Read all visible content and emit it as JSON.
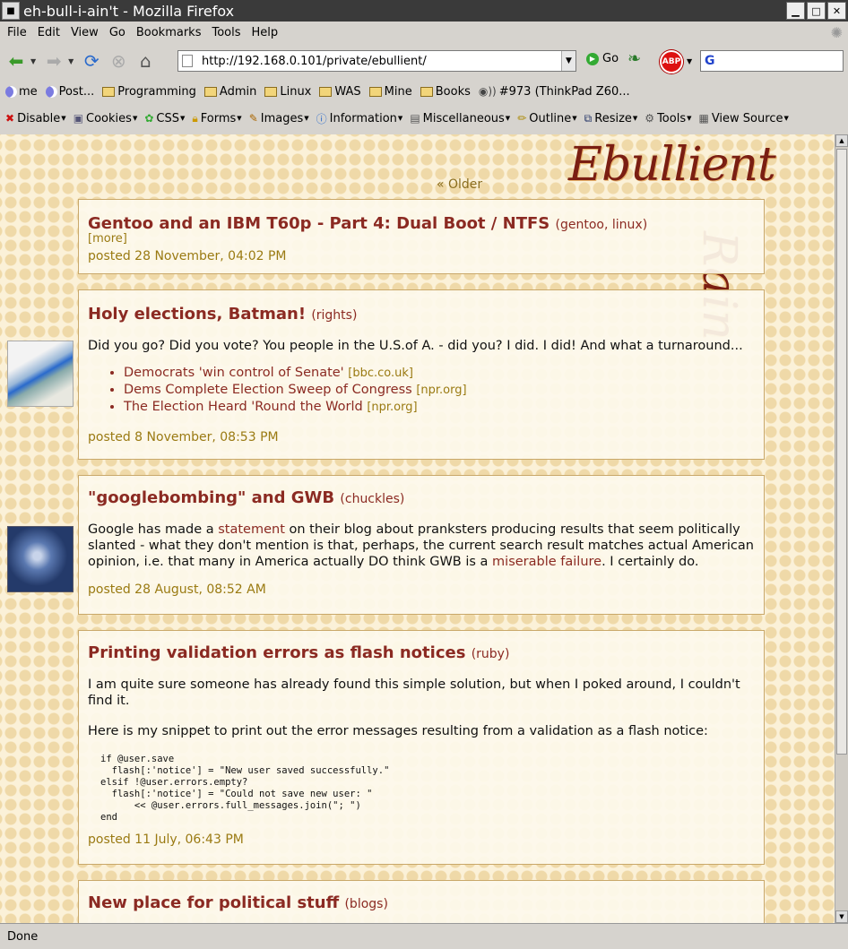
{
  "window": {
    "title": "eh-bull-i-ain't - Mozilla Firefox"
  },
  "menu": [
    "File",
    "Edit",
    "View",
    "Go",
    "Bookmarks",
    "Tools",
    "Help"
  ],
  "nav": {
    "url": "http://192.168.0.101/private/ebullient/",
    "go_label": "Go",
    "abp_label": "ABP",
    "search_logo": "G"
  },
  "bookmarks": [
    "me",
    "Post...",
    "Programming",
    "Admin",
    "Linux",
    "WAS",
    "Mine",
    "Books",
    "#973 (ThinkPad Z60..."
  ],
  "devtoolbar": [
    "Disable",
    "Cookies",
    "CSS",
    "Forms",
    "Images",
    "Information",
    "Miscellaneous",
    "Outline",
    "Resize",
    "Tools",
    "View Source"
  ],
  "site": {
    "logo_line1": "Ebullient",
    "logo_line2": "Rain",
    "older_link": "« Older"
  },
  "posts": [
    {
      "title": "Gentoo and an IBM T60p - Part 4: Dual Boot / NTFS",
      "tags": "(gentoo, linux)",
      "more": "[more]",
      "posted": "posted 28 November, 04:02 PM"
    },
    {
      "title": "Holy elections, Batman!",
      "tags": "(rights)",
      "body": "Did you go? Did you vote? You people in the U.S.of A. - did you? I did. I did! And what a turnaround...",
      "links": [
        {
          "text": "Democrats 'win control of Senate'",
          "src": "[bbc.co.uk]"
        },
        {
          "text": "Dems Complete Election Sweep of Congress",
          "src": "[npr.org]"
        },
        {
          "text": "The Election Heard 'Round the World",
          "src": "[npr.org]"
        }
      ],
      "posted": "posted 8 November, 08:53 PM"
    },
    {
      "title": "\"googlebombing\" and GWB",
      "tags": "(chuckles)",
      "body_a": "Google has made a ",
      "link1": "statement",
      "body_b": " on their blog about pranksters producing results that seem politically slanted - what they don't mention is that, perhaps, the current search result matches actual American opinion, i.e. that many in America actually DO think GWB is a ",
      "link2": "miserable failure",
      "body_c": ". I certainly do.",
      "posted": "posted 28 August, 08:52 AM"
    },
    {
      "title": "Printing validation errors as flash notices",
      "tags": "(ruby)",
      "body1": "I am quite sure someone has already found this simple solution, but when I poked around, I couldn't find it.",
      "body2": "Here is my snippet to print out the error messages resulting from a validation as a flash notice:",
      "code": "if @user.save\n  flash[:'notice'] = \"New user saved successfully.\"\nelsif !@user.errors.empty?\n  flash[:'notice'] = \"Could not save new user: \"\n      << @user.errors.full_messages.join(\"; \")\nend",
      "posted": "posted 11 July, 06:43 PM"
    },
    {
      "title": "New place for political stuff",
      "tags": "(blogs)"
    }
  ],
  "status": "Done"
}
